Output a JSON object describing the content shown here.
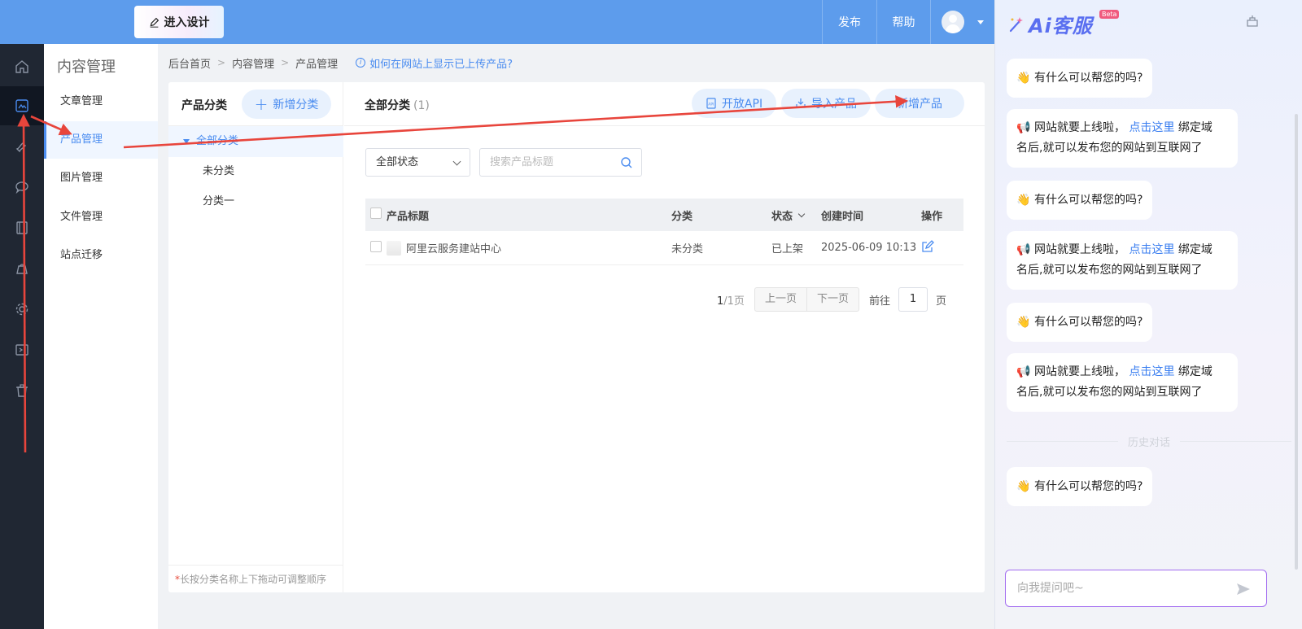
{
  "topbar": {
    "design_button": "进入设计",
    "publish": "发布",
    "help": "帮助"
  },
  "rail": {
    "items": [
      {
        "icon": "home-icon"
      },
      {
        "icon": "content-icon",
        "active": true
      },
      {
        "icon": "brush-icon"
      },
      {
        "icon": "chat-icon"
      },
      {
        "icon": "book-icon"
      },
      {
        "icon": "bag-icon"
      },
      {
        "icon": "gear-icon"
      },
      {
        "icon": "code-icon"
      },
      {
        "icon": "trash-icon"
      }
    ]
  },
  "subnav": {
    "title": "内容管理",
    "items": [
      {
        "label": "文章管理"
      },
      {
        "label": "产品管理",
        "active": true
      },
      {
        "label": "图片管理"
      },
      {
        "label": "文件管理"
      },
      {
        "label": "站点迁移"
      }
    ]
  },
  "breadcrumb": {
    "items": [
      "后台首页",
      "内容管理",
      "产品管理"
    ],
    "help_link": "如何在网站上显示已上传产品?"
  },
  "categories": {
    "title": "产品分类",
    "add_button": "新增分类",
    "tree": [
      {
        "label": "全部分类",
        "active": true
      },
      {
        "label": "未分类"
      },
      {
        "label": "分类一"
      }
    ],
    "footer_star": "*",
    "footer_hint": "长按分类名称上下拖动可调整顺序"
  },
  "content": {
    "title": "全部分类",
    "count": "(1)",
    "buttons": {
      "api": "开放API",
      "import": "导入产品",
      "add": "新增产品"
    },
    "status_filter": "全部状态",
    "search_placeholder": "搜索产品标题",
    "table": {
      "headers": {
        "title": "产品标题",
        "category": "分类",
        "status": "状态",
        "created": "创建时间",
        "action": "操作"
      },
      "rows": [
        {
          "title": "阿里云服务建站中心",
          "category": "未分类",
          "status": "已上架",
          "created": "2025-06-09 10:13"
        }
      ]
    },
    "pagination": {
      "current": "1",
      "total": "/1页",
      "prev": "上一页",
      "next": "下一页",
      "goto_label": "前往",
      "goto_value": "1",
      "goto_suffix": "页"
    }
  },
  "ai_panel": {
    "brand": "Ai客服",
    "badge": "Beta",
    "messages": [
      {
        "type": "greet",
        "emoji": "👋",
        "text": "有什么可以帮您的吗?"
      },
      {
        "type": "notice",
        "emoji": "📢",
        "text_before": "网站就要上线啦，",
        "link": "点击这里",
        "text_after": "绑定域",
        "line2": "名后,就可以发布您的网站到互联网了"
      },
      {
        "type": "greet",
        "emoji": "👋",
        "text": "有什么可以帮您的吗?"
      },
      {
        "type": "notice",
        "emoji": "📢",
        "text_before": "网站就要上线啦，",
        "link": "点击这里",
        "text_after": "绑定域",
        "line2": "名后,就可以发布您的网站到互联网了"
      },
      {
        "type": "greet",
        "emoji": "👋",
        "text": "有什么可以帮您的吗?"
      },
      {
        "type": "notice",
        "emoji": "📢",
        "text_before": "网站就要上线啦，",
        "link": "点击这里",
        "text_after": "绑定域",
        "line2": "名后,就可以发布您的网站到互联网了"
      },
      {
        "type": "greet",
        "emoji": "👋",
        "text": "有什么可以帮您的吗?"
      }
    ],
    "history_divider": "历史对话",
    "input_placeholder": "向我提问吧~"
  },
  "colors": {
    "topbar": "#5d9cec",
    "accent": "#4a8cf0",
    "rail": "#202733",
    "annotation_arrow": "#e8453c"
  }
}
